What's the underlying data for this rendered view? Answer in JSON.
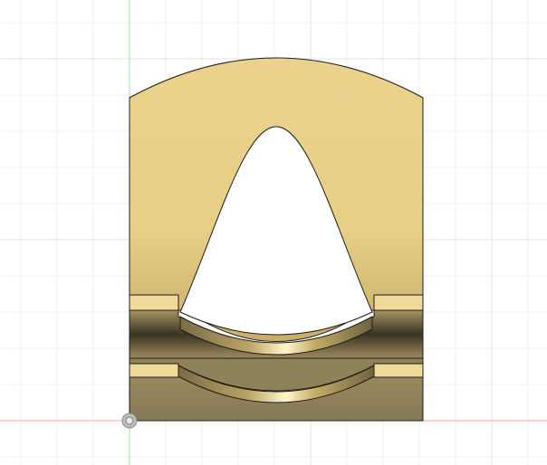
{
  "viewport": {
    "background": "#ffffff",
    "grid_minor_color": "#eef0f2",
    "grid_major_color": "#dfe3e6",
    "axis_y_color": "#9be3a4",
    "axis_x_color": "#f1a7a7"
  },
  "model": {
    "face_color": "#e9cf87",
    "face_shade": "#d8bd73",
    "base_color": "#8f8158",
    "edge_color": "#1d1d1d",
    "rail_light": "#f2e3a6",
    "rail_dark": "#6e6244"
  },
  "origin": {
    "icon": "origin-point-icon"
  }
}
